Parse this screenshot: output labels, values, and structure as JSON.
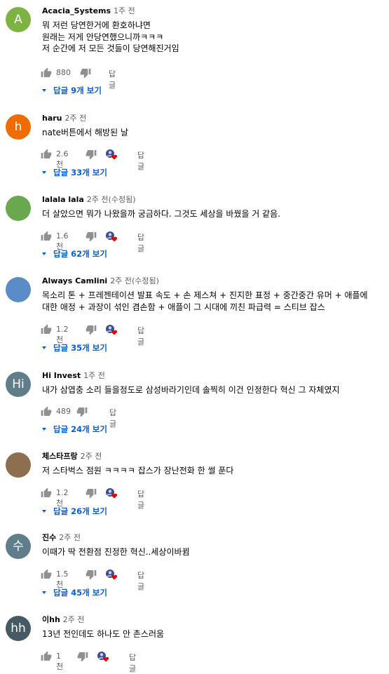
{
  "comments": [
    {
      "author": "Acacia_Systems",
      "time": "1주 전",
      "edited": "",
      "avatar_letter": "A",
      "avatar_color": "#7cb342",
      "text": "뭐 저런 당연한거에 환호하냐면\n원래는 저게 안당연했으니까ㅋㅋㅋ\n저 순간에 저 모든 것들이 당연해진거임",
      "likes": "880",
      "reply_label": "답글",
      "creator_heart": false,
      "replies_label": "답글 9개 보기"
    },
    {
      "author": "haru",
      "time": "2주 전",
      "edited": "",
      "avatar_letter": "h",
      "avatar_color": "#ef6c00",
      "text": "nate버튼에서 해방된 날",
      "likes": "2.6천",
      "reply_label": "답글",
      "creator_heart": true,
      "replies_label": "답글 33개 보기"
    },
    {
      "author": "lalala lala",
      "time": "2주 전",
      "edited": "(수정됨)",
      "avatar_letter": "",
      "avatar_color": "#6aa84f",
      "text": "더 살았으면 뭐가 나왔을까 궁금하다. 그것도 세상을 바꿨을 거 같음.",
      "likes": "1.6천",
      "reply_label": "답글",
      "creator_heart": true,
      "replies_label": "답글 62개 보기"
    },
    {
      "author": "Always Camlini",
      "time": "2주 전",
      "edited": "(수정됨)",
      "avatar_letter": "",
      "avatar_color": "#5b8cc7",
      "text": "목소리 톤 + 프레젠테이션 발표 속도 + 손 제스쳐 + 진지한 표정 + 중간중간 유머 + 애플에\n대한 애정 + 과장이 섞인 겸손함 + 애플이 그 시대에 끼친 파급력 = 스티브 잡스",
      "likes": "1.2천",
      "reply_label": "답글",
      "creator_heart": true,
      "replies_label": "답글 35개 보기"
    },
    {
      "author": "Hi Invest",
      "time": "1주 전",
      "edited": "",
      "avatar_letter": "Hi",
      "avatar_color": "#607d8b",
      "text": "내가 삼엽충 소리 들을정도로 삼성바라기인데 솔찍히 이건 인정한다 혁신 그 자체였지",
      "likes": "489",
      "reply_label": "답글",
      "creator_heart": false,
      "replies_label": "답글 24개 보기"
    },
    {
      "author": "체스타프랑",
      "time": "2주 전",
      "edited": "",
      "avatar_letter": "",
      "avatar_color": "#8d6e4f",
      "text": "저 스타벅스 점원 ㅋㅋㅋㅋ 잡스가 장난전화 한 썰 푼다",
      "likes": "1.2천",
      "reply_label": "답글",
      "creator_heart": true,
      "replies_label": "답글 26개 보기"
    },
    {
      "author": "진수",
      "time": "2주 전",
      "edited": "",
      "avatar_letter": "수",
      "avatar_color": "#607d8b",
      "text": "이때가 딱 전환점  진정한 혁신..세상이바뀜",
      "likes": "1.5천",
      "reply_label": "답글",
      "creator_heart": true,
      "replies_label": "답글 45개 보기"
    },
    {
      "author": "이hh",
      "time": "2주 전",
      "edited": "",
      "avatar_letter": "hh",
      "avatar_color": "#455a64",
      "text": "13년 전인데도 하나도 안 촌스러움",
      "likes": "1천",
      "reply_label": "답글",
      "creator_heart": true,
      "replies_label": ""
    }
  ]
}
